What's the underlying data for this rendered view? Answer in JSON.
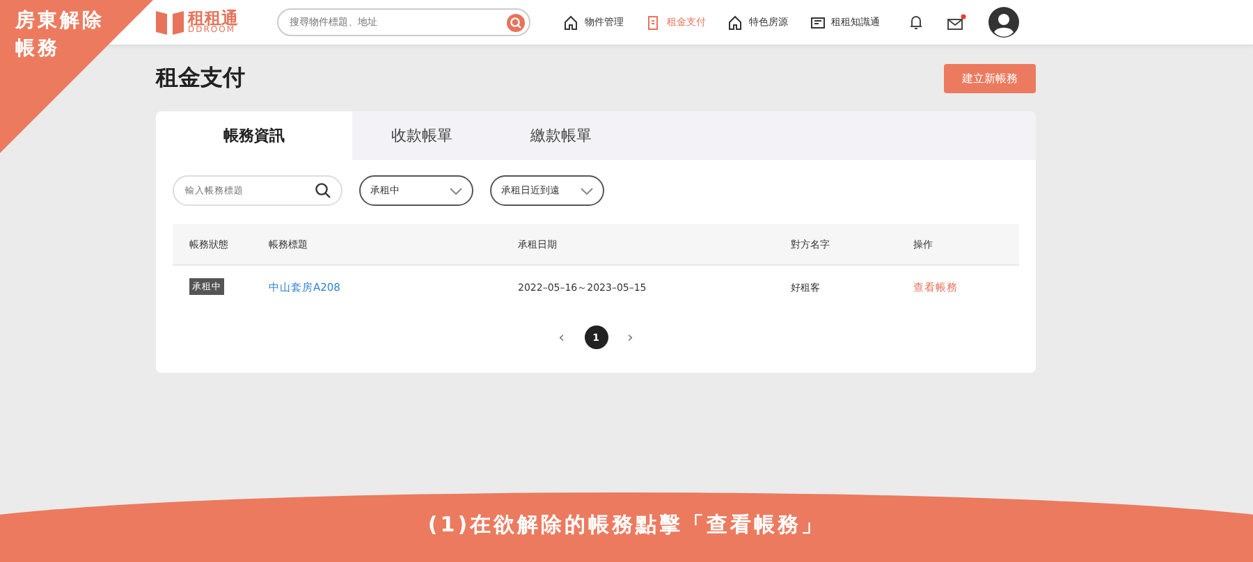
{
  "banner": {
    "text": "房東解除帳務"
  },
  "logo": {
    "name": "租租通",
    "subtitle": "DDROOM"
  },
  "search": {
    "placeholder": "搜尋物件標題、地址"
  },
  "nav": [
    {
      "label": "物件管理",
      "selected": false,
      "kind": "house"
    },
    {
      "label": "租金支付",
      "selected": true,
      "kind": "bill"
    },
    {
      "label": "特色房源",
      "selected": false,
      "kind": "house"
    },
    {
      "label": "租租知識通",
      "selected": false,
      "kind": "news"
    }
  ],
  "mail": {
    "unread": true
  },
  "page_title": "租金支付",
  "create_button": "建立新帳務",
  "tabs": [
    {
      "label": "帳務資訊",
      "selected": true
    },
    {
      "label": "收款帳單",
      "selected": false
    },
    {
      "label": "繳款帳單",
      "selected": false
    }
  ],
  "filter_search": {
    "placeholder": "輸入帳務標題"
  },
  "dropdowns": [
    {
      "value": "承租中"
    },
    {
      "value": "承租日近到遠"
    }
  ],
  "table": {
    "columns": [
      "帳務狀態",
      "帳務標題",
      "承租日期",
      "對方名字",
      "操作"
    ],
    "rows": [
      {
        "status": "承租中",
        "title": "中山套房A208",
        "dates": "2022–05–16～2023–05–15",
        "counterpart": "好租客",
        "action": "查看帳務"
      }
    ]
  },
  "pagination": {
    "prev": "‹",
    "next": "›",
    "pages": [
      {
        "label": "1",
        "selected": true
      }
    ]
  },
  "caption": "(1)在欲解除的帳務點擊「查看帳務」"
}
